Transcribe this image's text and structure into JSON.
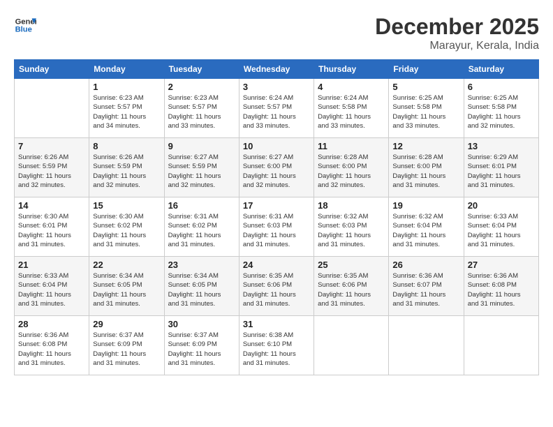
{
  "logo": {
    "line1": "General",
    "line2": "Blue"
  },
  "title": "December 2025",
  "subtitle": "Marayur, Kerala, India",
  "weekdays": [
    "Sunday",
    "Monday",
    "Tuesday",
    "Wednesday",
    "Thursday",
    "Friday",
    "Saturday"
  ],
  "weeks": [
    [
      {
        "day": "",
        "info": ""
      },
      {
        "day": "1",
        "info": "Sunrise: 6:23 AM\nSunset: 5:57 PM\nDaylight: 11 hours\nand 34 minutes."
      },
      {
        "day": "2",
        "info": "Sunrise: 6:23 AM\nSunset: 5:57 PM\nDaylight: 11 hours\nand 33 minutes."
      },
      {
        "day": "3",
        "info": "Sunrise: 6:24 AM\nSunset: 5:57 PM\nDaylight: 11 hours\nand 33 minutes."
      },
      {
        "day": "4",
        "info": "Sunrise: 6:24 AM\nSunset: 5:58 PM\nDaylight: 11 hours\nand 33 minutes."
      },
      {
        "day": "5",
        "info": "Sunrise: 6:25 AM\nSunset: 5:58 PM\nDaylight: 11 hours\nand 33 minutes."
      },
      {
        "day": "6",
        "info": "Sunrise: 6:25 AM\nSunset: 5:58 PM\nDaylight: 11 hours\nand 32 minutes."
      }
    ],
    [
      {
        "day": "7",
        "info": "Sunrise: 6:26 AM\nSunset: 5:59 PM\nDaylight: 11 hours\nand 32 minutes."
      },
      {
        "day": "8",
        "info": "Sunrise: 6:26 AM\nSunset: 5:59 PM\nDaylight: 11 hours\nand 32 minutes."
      },
      {
        "day": "9",
        "info": "Sunrise: 6:27 AM\nSunset: 5:59 PM\nDaylight: 11 hours\nand 32 minutes."
      },
      {
        "day": "10",
        "info": "Sunrise: 6:27 AM\nSunset: 6:00 PM\nDaylight: 11 hours\nand 32 minutes."
      },
      {
        "day": "11",
        "info": "Sunrise: 6:28 AM\nSunset: 6:00 PM\nDaylight: 11 hours\nand 32 minutes."
      },
      {
        "day": "12",
        "info": "Sunrise: 6:28 AM\nSunset: 6:00 PM\nDaylight: 11 hours\nand 31 minutes."
      },
      {
        "day": "13",
        "info": "Sunrise: 6:29 AM\nSunset: 6:01 PM\nDaylight: 11 hours\nand 31 minutes."
      }
    ],
    [
      {
        "day": "14",
        "info": "Sunrise: 6:30 AM\nSunset: 6:01 PM\nDaylight: 11 hours\nand 31 minutes."
      },
      {
        "day": "15",
        "info": "Sunrise: 6:30 AM\nSunset: 6:02 PM\nDaylight: 11 hours\nand 31 minutes."
      },
      {
        "day": "16",
        "info": "Sunrise: 6:31 AM\nSunset: 6:02 PM\nDaylight: 11 hours\nand 31 minutes."
      },
      {
        "day": "17",
        "info": "Sunrise: 6:31 AM\nSunset: 6:03 PM\nDaylight: 11 hours\nand 31 minutes."
      },
      {
        "day": "18",
        "info": "Sunrise: 6:32 AM\nSunset: 6:03 PM\nDaylight: 11 hours\nand 31 minutes."
      },
      {
        "day": "19",
        "info": "Sunrise: 6:32 AM\nSunset: 6:04 PM\nDaylight: 11 hours\nand 31 minutes."
      },
      {
        "day": "20",
        "info": "Sunrise: 6:33 AM\nSunset: 6:04 PM\nDaylight: 11 hours\nand 31 minutes."
      }
    ],
    [
      {
        "day": "21",
        "info": "Sunrise: 6:33 AM\nSunset: 6:04 PM\nDaylight: 11 hours\nand 31 minutes."
      },
      {
        "day": "22",
        "info": "Sunrise: 6:34 AM\nSunset: 6:05 PM\nDaylight: 11 hours\nand 31 minutes."
      },
      {
        "day": "23",
        "info": "Sunrise: 6:34 AM\nSunset: 6:05 PM\nDaylight: 11 hours\nand 31 minutes."
      },
      {
        "day": "24",
        "info": "Sunrise: 6:35 AM\nSunset: 6:06 PM\nDaylight: 11 hours\nand 31 minutes."
      },
      {
        "day": "25",
        "info": "Sunrise: 6:35 AM\nSunset: 6:06 PM\nDaylight: 11 hours\nand 31 minutes."
      },
      {
        "day": "26",
        "info": "Sunrise: 6:36 AM\nSunset: 6:07 PM\nDaylight: 11 hours\nand 31 minutes."
      },
      {
        "day": "27",
        "info": "Sunrise: 6:36 AM\nSunset: 6:08 PM\nDaylight: 11 hours\nand 31 minutes."
      }
    ],
    [
      {
        "day": "28",
        "info": "Sunrise: 6:36 AM\nSunset: 6:08 PM\nDaylight: 11 hours\nand 31 minutes."
      },
      {
        "day": "29",
        "info": "Sunrise: 6:37 AM\nSunset: 6:09 PM\nDaylight: 11 hours\nand 31 minutes."
      },
      {
        "day": "30",
        "info": "Sunrise: 6:37 AM\nSunset: 6:09 PM\nDaylight: 11 hours\nand 31 minutes."
      },
      {
        "day": "31",
        "info": "Sunrise: 6:38 AM\nSunset: 6:10 PM\nDaylight: 11 hours\nand 31 minutes."
      },
      {
        "day": "",
        "info": ""
      },
      {
        "day": "",
        "info": ""
      },
      {
        "day": "",
        "info": ""
      }
    ]
  ]
}
